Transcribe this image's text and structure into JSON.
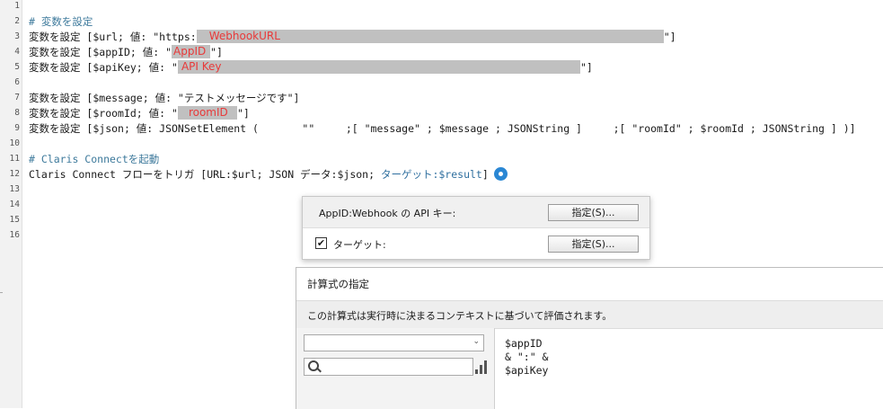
{
  "line_numbers": [
    "1",
    "2",
    "3",
    "4",
    "5",
    "6",
    "7",
    "8",
    "9",
    "10",
    "11",
    "12",
    "13",
    "14",
    "15",
    "16"
  ],
  "code": {
    "l2_comment": "# 変数を設定",
    "l3_prefix": "変数を設定 [$url; 値: \"https:",
    "l3_redact_label": "WebhookURL",
    "l3_suffix": "\"]",
    "l4_prefix": "変数を設定 [$appID; 値: \"",
    "l4_redact_label": "AppID",
    "l4_suffix": "\"]",
    "l5_prefix": "変数を設定 [$apiKey; 値: \"",
    "l5_redact_label": "API Key",
    "l5_suffix": "\"]",
    "l7": "変数を設定 [$message; 値: \"テストメッセージです\"]",
    "l8_prefix": "変数を設定 [$roomId; 値: \"",
    "l8_redact_label": "roomID",
    "l8_suffix": "\"]",
    "l9": "変数を設定 [$json; 値: JSONSetElement (       \"\"     ;[ \"message\" ; $message ; JSONString ]     ;[ \"roomId\" ; $roomId ; JSONString ] )]",
    "l11_comment": "# Claris Connectを起動",
    "l12_prefix": "Claris Connect フローをトリガ [URL:$url; JSON データ:$json; ",
    "l12_target": "ターゲット:$result",
    "l12_suffix": "]",
    "gear_icon": "gear-icon"
  },
  "popup": {
    "row1_label": "AppID:Webhook の API キー:",
    "row1_button": "指定(S)...",
    "row2_checkbox": "✔",
    "row2_label": "ターゲット:",
    "row2_button": "指定(S)..."
  },
  "dialog": {
    "title": "計算式の指定",
    "description": "この計算式は実行時に決まるコンテキストに基づいて評価されます。",
    "select_value": "",
    "search_placeholder": "",
    "formula": "$appID\n& \":\" &\n$apiKey"
  },
  "colors": {
    "redaction": "#c0c0c0",
    "redaction_text": "#e83a3a",
    "comment": "#3e7a9c",
    "gear": "#2a87d4"
  }
}
